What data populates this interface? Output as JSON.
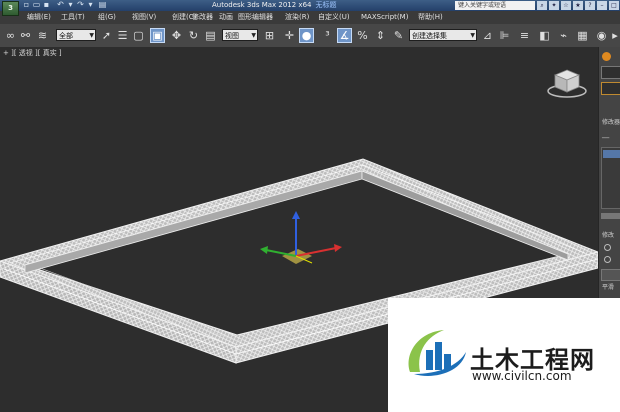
{
  "titlebar": {
    "title": "Autodesk 3ds Max  2012 x64",
    "doc_name": "无标题",
    "search_placeholder": "键入关键字或短语",
    "logo_text": "3"
  },
  "menu": [
    {
      "label": "编辑(E)"
    },
    {
      "label": "工具(T)"
    },
    {
      "label": "组(G)"
    },
    {
      "label": "视图(V)"
    },
    {
      "label": "创建(C)"
    },
    {
      "label": "修改器"
    },
    {
      "label": "动画"
    },
    {
      "label": "图形编辑器"
    },
    {
      "label": "渲染(R)"
    },
    {
      "label": "自定义(U)"
    },
    {
      "label": "MAXScript(M)"
    },
    {
      "label": "帮助(H)"
    }
  ],
  "toolbar": {
    "selection_filter": "全部",
    "reference_coord": "视图",
    "named_selection": "创建选择集"
  },
  "viewport": {
    "label": "+ ][ 透视 ][ 真实 ]"
  },
  "command_panel": {
    "modifier_list_label": "修改器列表",
    "rollout_label": "修改",
    "param_label": "平滑"
  },
  "watermark": {
    "name": "土木工程网",
    "url": "www.civilcn.com"
  },
  "colors": {
    "viewport_bg": "#2d2d2d",
    "wireframe": "#e6e6e6",
    "titlebar": "#2b4a75",
    "active_tool": "#6f95c8",
    "gizmo_x": "#d83030",
    "gizmo_y": "#30b030",
    "gizmo_z": "#3060e0",
    "logo_blue": "#1c6fb8",
    "logo_green": "#8bc34a"
  }
}
